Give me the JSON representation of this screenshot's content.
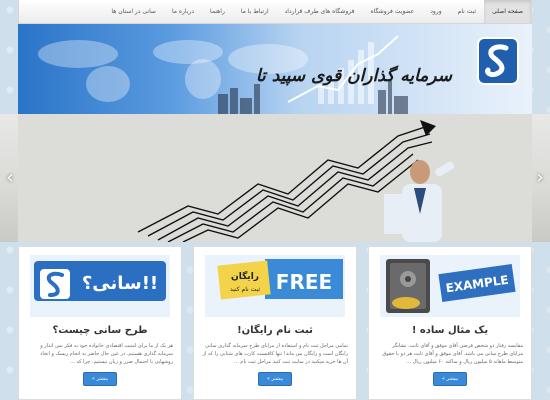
{
  "nav": {
    "items": [
      "صفحه اصلی",
      "ثبت نام",
      "ورود",
      "عضویت فروشگاه",
      "فروشگاه های طرف قرارداد",
      "ارتباط با ما",
      "راهنما",
      "درباره ما",
      "سانی در استان ها"
    ]
  },
  "banner": {
    "slogan": "سرمایه گذاران قوی سپید تا"
  },
  "slider": {
    "prev_arrow": "‹",
    "next_arrow": "›"
  },
  "cards": [
    {
      "image_caption": "EXAMPLE",
      "title": "یک مثال ساده !",
      "text": "مقایسه رفتار دو شخص فرضی آقای موفق و آقای ثابت. نشانگر مزایای طرح سانی می باشد. آقای موفق و آقای ثابت هر دو با حقوق متوسط ماهانه ۵ میلیون ریال و ساکنه ۶۰ میلیون ریال ...",
      "button": "بیشتر »"
    },
    {
      "image_caption": "FREE",
      "image_badge_1": "رایگان",
      "image_badge_2": "ثبت نام کنید",
      "title": "ثبت نام رایگان!",
      "text": "تمامی مراحل ثبت نام و استفاده از مزایای طرح سرمایه گذاری سانی رایگان است و رایگان می ماند! تنها کافیست کارت های شتابی را که از آن ها خرید میکنید در سایت ثبت کنید مراحل ثبت نام ...",
      "button": "بیشتر »"
    },
    {
      "image_caption": "سانی؟!!",
      "title": "طرح سانی چیست؟",
      "text": "هر یک از ما برای امنیت اقتصادی خانواده خود به فکر پس انداز و سرمایه گذاری هستیم. در عین حال حاضر به انجام ریسک و اتخاذ روشهایی با احتمال ضرر و زیان نیستیم. چرا که ...",
      "button": "بیشتر »"
    }
  ],
  "colors": {
    "accent": "#3a8ad8",
    "banner_blue": "#2a74c8"
  }
}
